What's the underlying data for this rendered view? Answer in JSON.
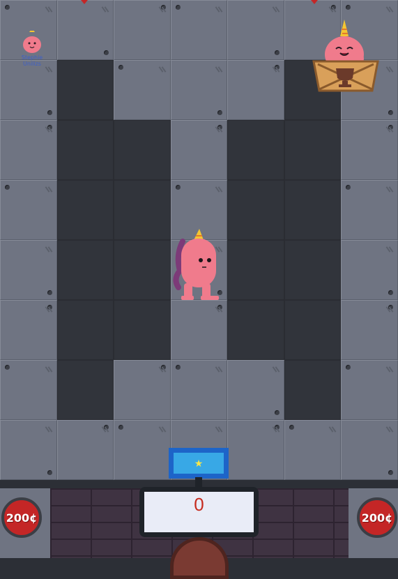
{
  "game": {
    "score": "0",
    "coin_buttons": {
      "left_label": "200¢",
      "right_label": "200¢"
    },
    "sticker": {
      "label_line1": "Stephie",
      "label_line2": "Unilizs"
    }
  },
  "board": {
    "cols": 7,
    "rows": 8,
    "pit_cells": [
      [
        1,
        1
      ],
      [
        1,
        2
      ],
      [
        1,
        3
      ],
      [
        1,
        4
      ],
      [
        1,
        5
      ],
      [
        1,
        6
      ],
      [
        2,
        2
      ],
      [
        2,
        3
      ],
      [
        2,
        4
      ],
      [
        2,
        5
      ],
      [
        4,
        2
      ],
      [
        4,
        3
      ],
      [
        4,
        4
      ],
      [
        4,
        5
      ],
      [
        5,
        1
      ],
      [
        5,
        2
      ],
      [
        5,
        3
      ],
      [
        5,
        4
      ],
      [
        5,
        5
      ],
      [
        5,
        6
      ]
    ]
  },
  "colors": {
    "tile": "#6f7482",
    "pit": "#31343b",
    "coin_button": "#c42626",
    "score_text": "#c62b1f",
    "flag": "#1d64c8",
    "character": "#f07b8c"
  },
  "icons": {
    "player": "pink-monster-with-party-hat",
    "opponent": "pink-blob-with-party-hat",
    "trophy": "trophy-icon",
    "star": "star-icon",
    "crate": "wooden-crate-icon"
  }
}
